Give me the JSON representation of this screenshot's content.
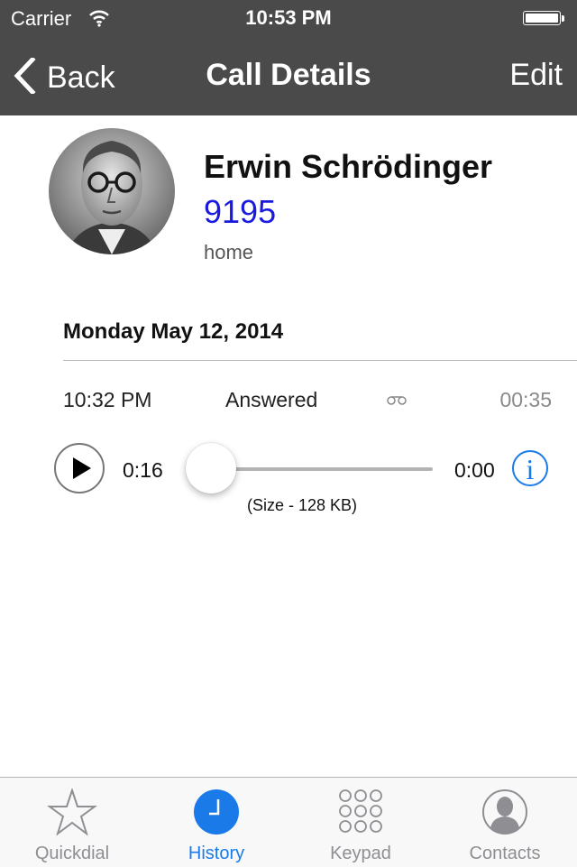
{
  "status_bar": {
    "carrier": "Carrier",
    "time": "10:53 PM",
    "wifi_icon": "wifi-icon",
    "battery_icon": "battery-icon"
  },
  "nav": {
    "back_label": "Back",
    "title": "Call Details",
    "edit_label": "Edit"
  },
  "contact": {
    "name": "Erwin Schrödinger",
    "number": "9195",
    "number_type": "home",
    "avatar": "contact-photo"
  },
  "call": {
    "date": "Monday May 12, 2014",
    "time": "10:32 PM",
    "status": "Answered",
    "voicemail_icon": "voicemail-icon",
    "duration": "00:35"
  },
  "player": {
    "elapsed": "0:16",
    "remaining": "0:00",
    "progress": 0,
    "file_size": "(Size - 128 KB)",
    "info_glyph": "i",
    "colors": {
      "accent": "#1a7be8"
    }
  },
  "tabs": [
    {
      "label": "Quickdial",
      "icon": "star-icon",
      "active": false
    },
    {
      "label": "History",
      "icon": "clock-icon",
      "active": true
    },
    {
      "label": "Keypad",
      "icon": "keypad-icon",
      "active": false
    },
    {
      "label": "Contacts",
      "icon": "contact-icon",
      "active": false
    }
  ],
  "colors": {
    "nav_bar": "#4a4a4a",
    "number_link": "#1a1adf",
    "tab_active": "#1a7be8",
    "tab_inactive": "#8e8e93"
  }
}
